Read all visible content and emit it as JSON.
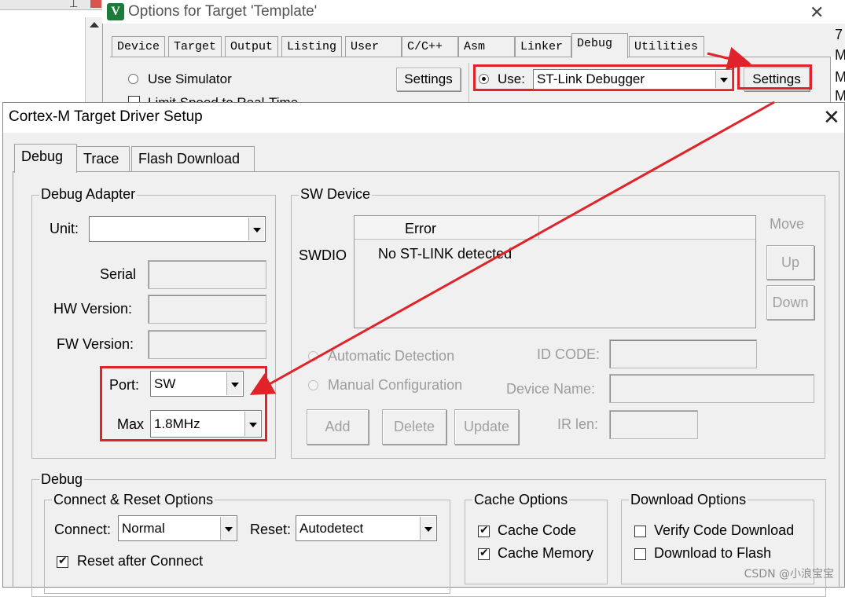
{
  "options_window": {
    "title": "Options for Target 'Template'",
    "logo_letter": "V",
    "tabs": [
      {
        "label": "Device"
      },
      {
        "label": "Target"
      },
      {
        "label": "Output"
      },
      {
        "label": "Listing"
      },
      {
        "label": "User"
      },
      {
        "label": "C/C++"
      },
      {
        "label": "Asm"
      },
      {
        "label": "Linker"
      },
      {
        "label": "Debug",
        "active": true
      },
      {
        "label": "Utilities"
      }
    ],
    "use_simulator_label": "Use Simulator",
    "limit_speed_label": "Limit Speed to Real-Time",
    "settings_left_label": "Settings",
    "use_label": "Use:",
    "debugger_value": "ST-Link Debugger",
    "settings_right_label": "Settings",
    "right_edge_chars": [
      "7",
      "M",
      "M",
      "M"
    ]
  },
  "dialog": {
    "title": "Cortex-M Target Driver Setup",
    "tabs": [
      {
        "label": "Debug",
        "active": true
      },
      {
        "label": "Trace"
      },
      {
        "label": "Flash Download"
      }
    ],
    "debug_adapter": {
      "title": "Debug Adapter",
      "unit_label": "Unit:",
      "unit_value": "",
      "serial_label": "Serial",
      "hw_version_label": "HW Version:",
      "fw_version_label": "FW Version:",
      "port_label": "Port:",
      "port_value": "SW",
      "max_label": "Max",
      "max_value": "1.8MHz"
    },
    "sw_device": {
      "title": "SW Device",
      "swdio_label": "SWDIO",
      "column_error": "Error",
      "error_text": "No ST-LINK detected",
      "move_label": "Move",
      "up_label": "Up",
      "down_label": "Down",
      "automatic_detection": "Automatic Detection",
      "manual_configuration": "Manual Configuration",
      "id_code_label": "ID CODE:",
      "device_name_label": "Device Name:",
      "add_label": "Add",
      "delete_label": "Delete",
      "update_label": "Update",
      "ir_len_label": "IR len:"
    },
    "debug": {
      "title": "Debug",
      "connect_reset": {
        "title": "Connect & Reset Options",
        "connect_label": "Connect:",
        "connect_value": "Normal",
        "reset_label": "Reset:",
        "reset_value": "Autodetect",
        "reset_after_connect": "Reset after Connect",
        "reset_after_connect_checked": true
      },
      "cache_options": {
        "title": "Cache Options",
        "cache_code": "Cache Code",
        "cache_code_checked": true,
        "cache_memory": "Cache Memory",
        "cache_memory_checked": true
      },
      "download_options": {
        "title": "Download Options",
        "verify_code_download": "Verify Code Download",
        "verify_checked": false,
        "download_to_flash": "Download to Flash",
        "download_checked": false
      }
    }
  },
  "watermark": "CSDN @小浪宝宝",
  "annotation_color": "#e0232a"
}
